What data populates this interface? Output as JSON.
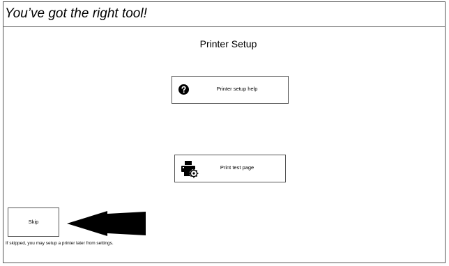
{
  "header": {
    "title": "You’ve got the right tool!"
  },
  "main": {
    "heading": "Printer Setup",
    "help_button": {
      "label": "Printer setup help",
      "icon": "question-circle-icon"
    },
    "test_page_button": {
      "label": "Print test page",
      "icon": "printer-gear-icon"
    }
  },
  "footer": {
    "skip_label": "Skip",
    "arrow_icon": "left-arrow-icon",
    "skip_note": "If skipped, you may setup a printer later from settings."
  },
  "colors": {
    "border": "#555555",
    "background": "#ffffff",
    "text": "#000000"
  }
}
